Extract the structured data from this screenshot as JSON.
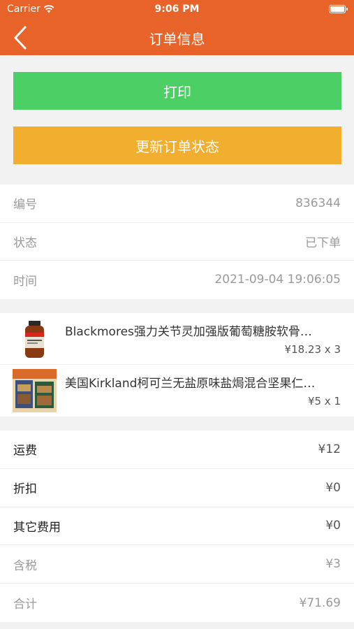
{
  "status_bar": {
    "carrier": "Carrier",
    "time": "9:06 PM"
  },
  "nav": {
    "title": "订单信息",
    "back_icon": "chevron-left-icon"
  },
  "actions": {
    "print_label": "打印",
    "update_label": "更新订单状态"
  },
  "colors": {
    "header": "#e8632a",
    "print": "#4cd065",
    "update": "#f2ae2f"
  },
  "order_info": [
    {
      "label": "编号",
      "value": "836344"
    },
    {
      "label": "状态",
      "value": "已下单"
    },
    {
      "label": "时间",
      "value": "2021-09-04 19:06:05"
    }
  ],
  "products": [
    {
      "name": "Blackmores强力关节灵加强版葡萄糖胺软骨…",
      "price": "¥18.23 x 3"
    },
    {
      "name": "美国Kirkland柯可兰无盐原味盐焗混合坚果仁…",
      "price": "¥5 x 1"
    }
  ],
  "fees": [
    {
      "label": "运费",
      "value": "¥12"
    },
    {
      "label": "折扣",
      "value": "¥0"
    },
    {
      "label": "其它费用",
      "value": "¥0"
    },
    {
      "label": "含税",
      "value": "¥3"
    },
    {
      "label": "合计",
      "value": "¥71.69"
    }
  ]
}
